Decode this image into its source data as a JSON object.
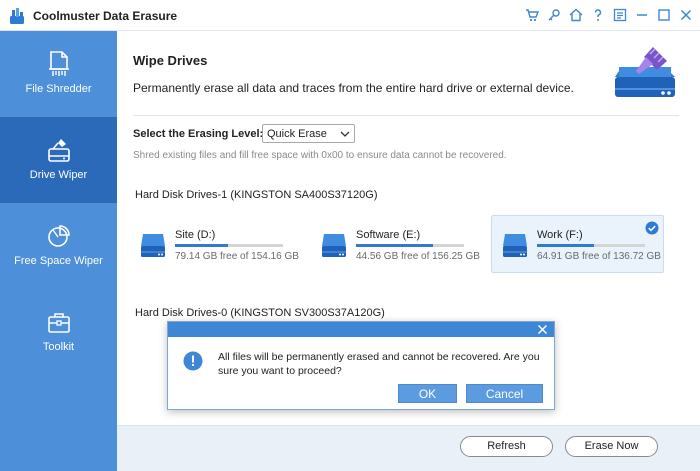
{
  "app": {
    "title": "Coolmuster Data Erasure",
    "logo_icon": "eraser-drive-logo",
    "titlebar_icons": [
      "cart-icon",
      "key-icon",
      "home-icon",
      "help-icon",
      "feedback-icon",
      "minimize-icon",
      "maximize-icon",
      "close-icon"
    ]
  },
  "sidebar": {
    "items": [
      {
        "label": "File Shredder",
        "icon": "file-shredder-icon",
        "active": false
      },
      {
        "label": "Drive Wiper",
        "icon": "drive-wiper-icon",
        "active": true
      },
      {
        "label": "Free Space Wiper",
        "icon": "pie-chart-icon",
        "active": false
      },
      {
        "label": "Toolkit",
        "icon": "toolbox-icon",
        "active": false
      }
    ]
  },
  "main": {
    "title": "Wipe Drives",
    "subtitle": "Permanently erase all data and traces from the entire hard drive or external device.",
    "erasing_level": {
      "label": "Select the Erasing Level:",
      "selected": "Quick Erase",
      "hint": "Shred existing files and fill free space with 0x00 to ensure data cannot be recovered."
    },
    "groups": [
      {
        "title": "Hard Disk Drives-1 (KINGSTON SA400S37120G)",
        "drives": [
          {
            "name": "Site (D:)",
            "free": "79.14 GB free of 154.16 GB",
            "used_fraction": 0.49,
            "selected": false
          },
          {
            "name": "Software (E:)",
            "free": "44.56 GB free of 156.25 GB",
            "used_fraction": 0.71,
            "selected": false
          },
          {
            "name": "Work (F:)",
            "free": "64.91 GB free of 136.72 GB",
            "used_fraction": 0.53,
            "selected": true
          }
        ]
      },
      {
        "title": "Hard Disk Drives-0 (KINGSTON SV300S37A120G)",
        "drives": []
      }
    ]
  },
  "footer": {
    "refresh_label": "Refresh",
    "erase_label": "Erase Now"
  },
  "dialog": {
    "message": "All files will be permanently erased and cannot be recovered. Are you sure you want to proceed?",
    "ok_label": "OK",
    "cancel_label": "Cancel",
    "icon": "info-icon"
  },
  "colors": {
    "sidebar": "#4d8fd9",
    "sidebar_active": "#2a6ab8",
    "accent": "#2f7ad5",
    "dialog_header": "#3e86d6",
    "dialog_button": "#5d9be0"
  }
}
